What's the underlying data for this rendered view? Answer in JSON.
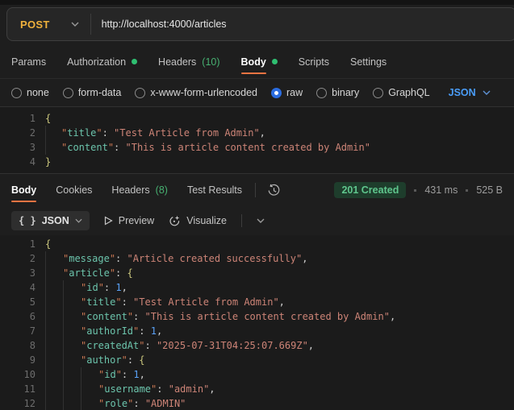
{
  "request": {
    "method": "POST",
    "url": "http://localhost:4000/articles",
    "tabs": [
      {
        "label": "Params"
      },
      {
        "label": "Authorization",
        "dot": true
      },
      {
        "label": "Headers",
        "badge": "(10)"
      },
      {
        "label": "Body",
        "dot": true,
        "active": true
      },
      {
        "label": "Scripts"
      },
      {
        "label": "Settings"
      }
    ],
    "body_types": [
      {
        "label": "none"
      },
      {
        "label": "form-data"
      },
      {
        "label": "x-www-form-urlencoded"
      },
      {
        "label": "raw",
        "selected": true
      },
      {
        "label": "binary"
      },
      {
        "label": "GraphQL"
      }
    ],
    "raw_format": "JSON",
    "editor": {
      "lines": [
        {
          "n": "1",
          "indent": 0,
          "tokens": [
            {
              "c": "brace",
              "v": "{"
            }
          ]
        },
        {
          "n": "2",
          "indent": 1,
          "tokens": [
            {
              "c": "q",
              "v": "\""
            },
            {
              "c": "key",
              "v": "title"
            },
            {
              "c": "q",
              "v": "\""
            },
            {
              "c": "punct",
              "v": ": "
            },
            {
              "c": "str",
              "v": "\"Test Article from Admin\""
            },
            {
              "c": "punct",
              "v": ","
            }
          ]
        },
        {
          "n": "3",
          "indent": 1,
          "tokens": [
            {
              "c": "q",
              "v": "\""
            },
            {
              "c": "key",
              "v": "content"
            },
            {
              "c": "q",
              "v": "\""
            },
            {
              "c": "punct",
              "v": ": "
            },
            {
              "c": "str",
              "v": "\"This is article content created by Admin\""
            }
          ]
        },
        {
          "n": "4",
          "indent": 0,
          "tokens": [
            {
              "c": "brace",
              "v": "}"
            }
          ]
        }
      ]
    }
  },
  "response": {
    "tabs": [
      {
        "label": "Body",
        "active": true
      },
      {
        "label": "Cookies"
      },
      {
        "label": "Headers",
        "badge": "(8)"
      },
      {
        "label": "Test Results"
      }
    ],
    "status": "201 Created",
    "time": "431 ms",
    "size": "525 B",
    "toolbar": {
      "format": "JSON",
      "preview_label": "Preview",
      "visualize_label": "Visualize"
    },
    "editor": {
      "lines": [
        {
          "n": "1",
          "indent": 0,
          "tokens": [
            {
              "c": "brace",
              "v": "{"
            }
          ]
        },
        {
          "n": "2",
          "indent": 1,
          "tokens": [
            {
              "c": "q",
              "v": "\""
            },
            {
              "c": "key",
              "v": "message"
            },
            {
              "c": "q",
              "v": "\""
            },
            {
              "c": "punct",
              "v": ": "
            },
            {
              "c": "str",
              "v": "\"Article created successfully\""
            },
            {
              "c": "punct",
              "v": ","
            }
          ]
        },
        {
          "n": "3",
          "indent": 1,
          "tokens": [
            {
              "c": "q",
              "v": "\""
            },
            {
              "c": "key",
              "v": "article"
            },
            {
              "c": "q",
              "v": "\""
            },
            {
              "c": "punct",
              "v": ": "
            },
            {
              "c": "brace",
              "v": "{"
            }
          ]
        },
        {
          "n": "4",
          "indent": 2,
          "tokens": [
            {
              "c": "q",
              "v": "\""
            },
            {
              "c": "key",
              "v": "id"
            },
            {
              "c": "q",
              "v": "\""
            },
            {
              "c": "punct",
              "v": ": "
            },
            {
              "c": "num",
              "v": "1"
            },
            {
              "c": "punct",
              "v": ","
            }
          ]
        },
        {
          "n": "5",
          "indent": 2,
          "tokens": [
            {
              "c": "q",
              "v": "\""
            },
            {
              "c": "key",
              "v": "title"
            },
            {
              "c": "q",
              "v": "\""
            },
            {
              "c": "punct",
              "v": ": "
            },
            {
              "c": "str",
              "v": "\"Test Article from Admin\""
            },
            {
              "c": "punct",
              "v": ","
            }
          ]
        },
        {
          "n": "6",
          "indent": 2,
          "tokens": [
            {
              "c": "q",
              "v": "\""
            },
            {
              "c": "key",
              "v": "content"
            },
            {
              "c": "q",
              "v": "\""
            },
            {
              "c": "punct",
              "v": ": "
            },
            {
              "c": "str",
              "v": "\"This is article content created by Admin\""
            },
            {
              "c": "punct",
              "v": ","
            }
          ]
        },
        {
          "n": "7",
          "indent": 2,
          "tokens": [
            {
              "c": "q",
              "v": "\""
            },
            {
              "c": "key",
              "v": "authorId"
            },
            {
              "c": "q",
              "v": "\""
            },
            {
              "c": "punct",
              "v": ": "
            },
            {
              "c": "num",
              "v": "1"
            },
            {
              "c": "punct",
              "v": ","
            }
          ]
        },
        {
          "n": "8",
          "indent": 2,
          "tokens": [
            {
              "c": "q",
              "v": "\""
            },
            {
              "c": "key",
              "v": "createdAt"
            },
            {
              "c": "q",
              "v": "\""
            },
            {
              "c": "punct",
              "v": ": "
            },
            {
              "c": "str",
              "v": "\"2025-07-31T04:25:07.669Z\""
            },
            {
              "c": "punct",
              "v": ","
            }
          ]
        },
        {
          "n": "9",
          "indent": 2,
          "tokens": [
            {
              "c": "q",
              "v": "\""
            },
            {
              "c": "key",
              "v": "author"
            },
            {
              "c": "q",
              "v": "\""
            },
            {
              "c": "punct",
              "v": ": "
            },
            {
              "c": "brace",
              "v": "{"
            }
          ]
        },
        {
          "n": "10",
          "indent": 3,
          "tokens": [
            {
              "c": "q",
              "v": "\""
            },
            {
              "c": "key",
              "v": "id"
            },
            {
              "c": "q",
              "v": "\""
            },
            {
              "c": "punct",
              "v": ": "
            },
            {
              "c": "num",
              "v": "1"
            },
            {
              "c": "punct",
              "v": ","
            }
          ]
        },
        {
          "n": "11",
          "indent": 3,
          "tokens": [
            {
              "c": "q",
              "v": "\""
            },
            {
              "c": "key",
              "v": "username"
            },
            {
              "c": "q",
              "v": "\""
            },
            {
              "c": "punct",
              "v": ": "
            },
            {
              "c": "str",
              "v": "\"admin\""
            },
            {
              "c": "punct",
              "v": ","
            }
          ]
        },
        {
          "n": "12",
          "indent": 3,
          "tokens": [
            {
              "c": "q",
              "v": "\""
            },
            {
              "c": "key",
              "v": "role"
            },
            {
              "c": "q",
              "v": "\""
            },
            {
              "c": "punct",
              "v": ": "
            },
            {
              "c": "str",
              "v": "\"ADMIN\""
            }
          ]
        }
      ]
    }
  },
  "colors": {
    "accent_orange": "#ee7442",
    "method_post": "#f0b13c",
    "green": "#47b071",
    "status_green": "#5fc68d",
    "link_blue": "#4a9df8"
  }
}
